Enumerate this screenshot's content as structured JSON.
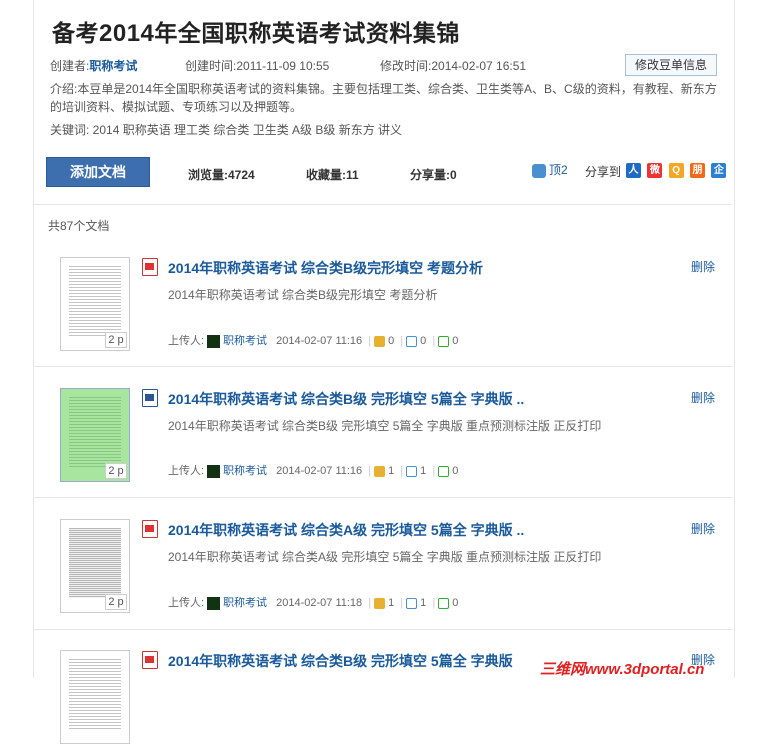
{
  "header": {
    "title_prefix": "备考",
    "title_year": "2014",
    "title_suffix": "年全国职称英语考试资料集锦",
    "creator_label": "创建者:",
    "creator_name": "职称考试",
    "created_label": "创建时间:",
    "created_time": "2011-11-09 10:55",
    "modified_label": "修改时间:",
    "modified_time": "2014-02-07 16:51",
    "edit_label": "修改豆单信息",
    "intro": "介绍:本豆单是2014年全国职称英语考试的资料集锦。主要包括理工类、综合类、卫生类等A、B、C级的资料，有教程、新东方的培训资料、模拟试题、专项练习以及押题等。",
    "keywords": "关键词: 2014 职称英语 理工类 综合类 卫生类 A级 B级 新东方 讲义"
  },
  "toolbar": {
    "add_label": "添加文档",
    "views": "浏览量:4724",
    "favorites": "收藏量:11",
    "shares": "分享量:0",
    "like_label": "顶2",
    "share_label": "分享到"
  },
  "list": {
    "count_label": "共87个文档",
    "items": [
      {
        "title": "2014年职称英语考试 综合类B级完形填空 考题分析",
        "desc": "2014年职称英语考试 综合类B级完形填空 考题分析",
        "pages": "2 p",
        "uploader_label": "上传人:",
        "author": "职称考试",
        "time": "2014-02-07 11:16",
        "likes": "0",
        "comments": "0",
        "saves": "0",
        "delete": "删除"
      },
      {
        "title": "2014年职称英语考试 综合类B级 完形填空 5篇全 字典版 ..",
        "desc": "2014年职称英语考试 综合类B级 完形填空 5篇全 字典版 重点预测标注版 正反打印",
        "pages": "2 p",
        "uploader_label": "上传人:",
        "author": "职称考试",
        "time": "2014-02-07 11:16",
        "likes": "1",
        "comments": "1",
        "saves": "0",
        "delete": "删除"
      },
      {
        "title": "2014年职称英语考试 综合类A级 完形填空 5篇全 字典版 ..",
        "desc": "2014年职称英语考试 综合类A级 完形填空 5篇全 字典版 重点预测标注版 正反打印",
        "pages": "2 p",
        "uploader_label": "上传人:",
        "author": "职称考试",
        "time": "2014-02-07 11:18",
        "likes": "1",
        "comments": "1",
        "saves": "0",
        "delete": "删除"
      },
      {
        "title": "2014年职称英语考试 综合类B级 完形填空 5篇全 字典版",
        "delete": "删除"
      }
    ]
  },
  "watermark": "三维网www.3dportal.cn"
}
